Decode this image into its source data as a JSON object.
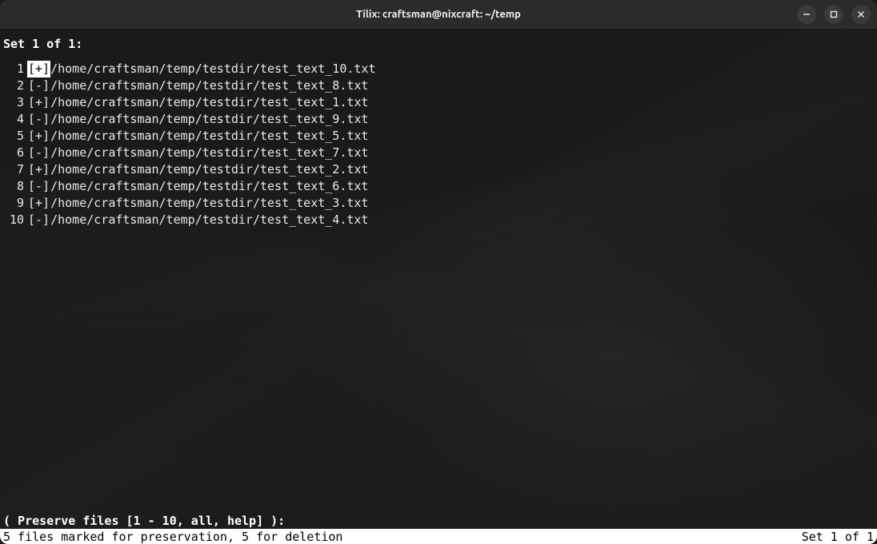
{
  "window": {
    "title": "Tilix: craftsman@nixcraft: ~/temp"
  },
  "header": {
    "set_label": "Set 1 of 1:"
  },
  "files": [
    {
      "n": "1",
      "marker": "[+]",
      "selected": true,
      "path": "/home/craftsman/temp/testdir/test_text_10.txt"
    },
    {
      "n": "2",
      "marker": "[-]",
      "selected": false,
      "path": "/home/craftsman/temp/testdir/test_text_8.txt"
    },
    {
      "n": "3",
      "marker": "[+]",
      "selected": false,
      "path": "/home/craftsman/temp/testdir/test_text_1.txt"
    },
    {
      "n": "4",
      "marker": "[-]",
      "selected": false,
      "path": "/home/craftsman/temp/testdir/test_text_9.txt"
    },
    {
      "n": "5",
      "marker": "[+]",
      "selected": false,
      "path": "/home/craftsman/temp/testdir/test_text_5.txt"
    },
    {
      "n": "6",
      "marker": "[-]",
      "selected": false,
      "path": "/home/craftsman/temp/testdir/test_text_7.txt"
    },
    {
      "n": "7",
      "marker": "[+]",
      "selected": false,
      "path": "/home/craftsman/temp/testdir/test_text_2.txt"
    },
    {
      "n": "8",
      "marker": "[-]",
      "selected": false,
      "path": "/home/craftsman/temp/testdir/test_text_6.txt"
    },
    {
      "n": "9",
      "marker": "[+]",
      "selected": false,
      "path": "/home/craftsman/temp/testdir/test_text_3.txt"
    },
    {
      "n": "10",
      "marker": "[-]",
      "selected": false,
      "path": "/home/craftsman/temp/testdir/test_text_4.txt"
    }
  ],
  "prompt": {
    "text": "( Preserve files [1 - 10, all, help] ):"
  },
  "status": {
    "left": "5 files marked for preservation, 5 for deletion",
    "right": "Set 1 of 1"
  }
}
